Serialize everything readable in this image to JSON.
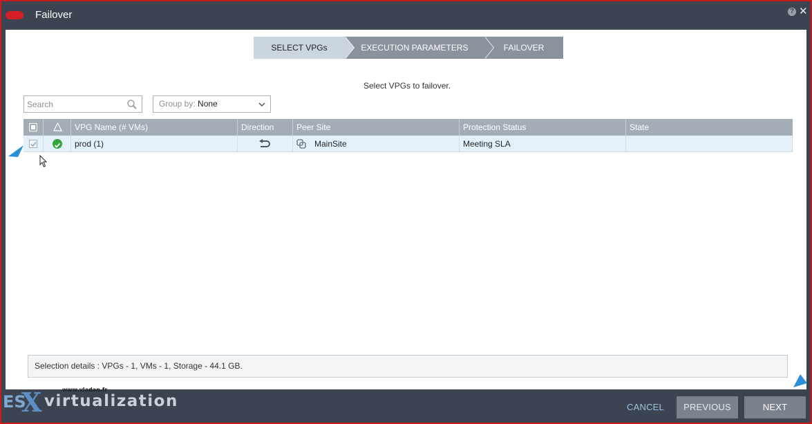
{
  "window": {
    "title": "Failover",
    "help_label": "?",
    "close_label": "✕"
  },
  "wizard": {
    "steps": [
      {
        "label": "SELECT VPGs",
        "active": true
      },
      {
        "label": "EXECUTION PARAMETERS",
        "active": false
      },
      {
        "label": "FAILOVER",
        "active": false
      }
    ]
  },
  "instruction": "Select VPGs to failover.",
  "search": {
    "placeholder": "Search",
    "value": ""
  },
  "group_by": {
    "label": "Group by:",
    "value": "None"
  },
  "grid": {
    "columns": [
      "VPG Name (# VMs)",
      "Direction",
      "Peer Site",
      "Protection Status",
      "State"
    ],
    "rows": [
      {
        "checked": true,
        "status_icon": "ok-check-icon",
        "vpg_name": "prod (1)",
        "direction_icon": "return-arrow-icon",
        "peer_site_icon": "vsphere-site-icon",
        "peer_site": "MainSite",
        "protection_status": "Meeting SLA",
        "state": ""
      }
    ]
  },
  "selection_details": "Selection details :  VPGs  -  1, VMs  -  1, Storage  -  44.1 GB.",
  "footer": {
    "cancel": "CANCEL",
    "previous": "PREVIOUS",
    "next": "NEXT"
  },
  "watermark": {
    "url": "www.vladan.fr",
    "es": "ES",
    "x": "X",
    "rest": "virtualization"
  },
  "colors": {
    "titlebar": "#3b4450",
    "header_grid": "#a4adb6",
    "selected_row": "#e5f1fa",
    "ok_green": "#35a43a",
    "annotation_arrow": "#2a8fd6",
    "frame_red": "#c81c1c"
  }
}
